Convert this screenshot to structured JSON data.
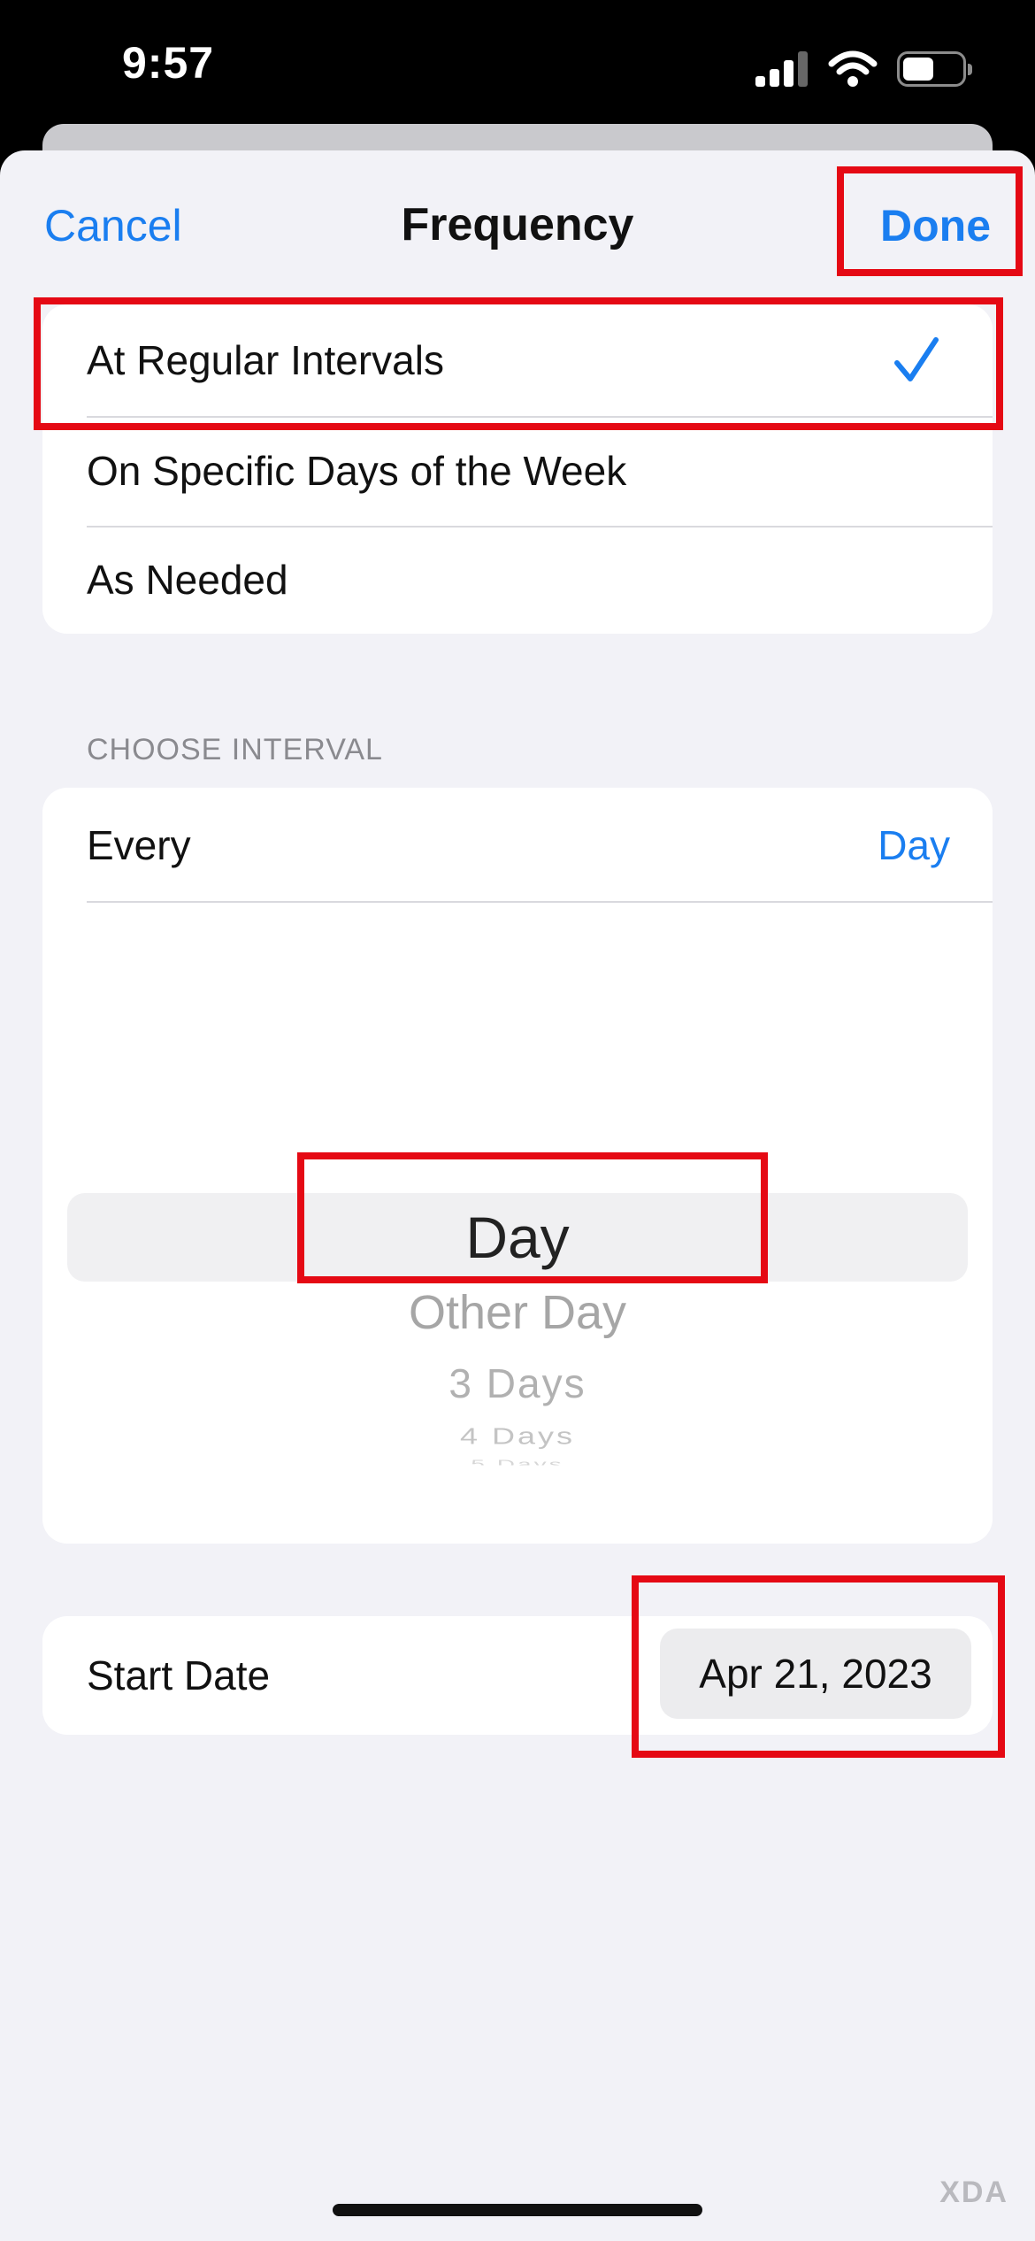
{
  "status_bar": {
    "time": "9:57",
    "icons": [
      "cellular-signal-icon",
      "wifi-icon",
      "battery-icon"
    ]
  },
  "nav": {
    "cancel_label": "Cancel",
    "title": "Frequency",
    "done_label": "Done"
  },
  "frequency_options": [
    {
      "label": "At Regular Intervals",
      "selected": true
    },
    {
      "label": "On Specific Days of the Week",
      "selected": false
    },
    {
      "label": "As Needed",
      "selected": false
    }
  ],
  "interval": {
    "section_header": "CHOOSE INTERVAL",
    "every_label": "Every",
    "every_value": "Day",
    "picker_options": [
      "Day",
      "Other Day",
      "3 Days",
      "4 Days",
      "5 Days"
    ],
    "picker_selected": "Day"
  },
  "start_date": {
    "label": "Start Date",
    "value": "Apr 21, 2023"
  },
  "watermark": "XDA",
  "colors": {
    "accent": "#1a7ef0",
    "highlight_box": "#e50914",
    "background": "#f2f2f7"
  }
}
